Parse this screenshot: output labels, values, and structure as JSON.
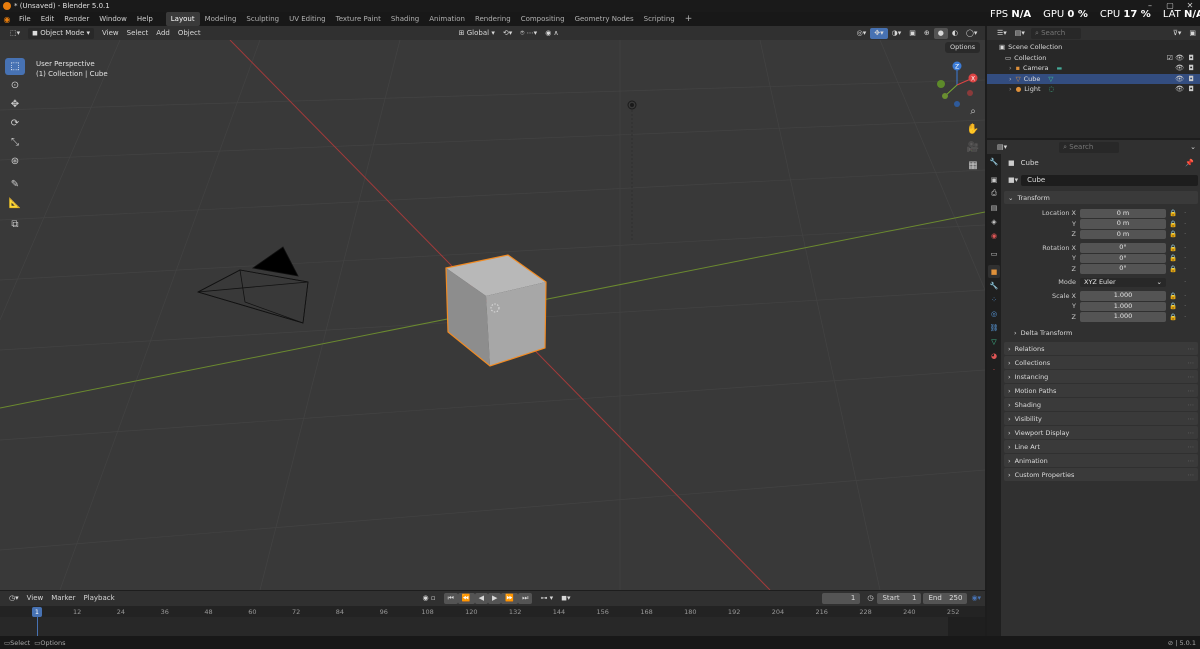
{
  "window": {
    "title": "* (Unsaved) - Blender 5.0.1"
  },
  "menus": [
    "File",
    "Edit",
    "Render",
    "Window",
    "Help"
  ],
  "workspaces": [
    "Layout",
    "Modeling",
    "Sculpting",
    "UV Editing",
    "Texture Paint",
    "Shading",
    "Animation",
    "Rendering",
    "Compositing",
    "Geometry Nodes",
    "Scripting"
  ],
  "active_workspace": "Layout",
  "overlay_stats": {
    "fps_label": "FPS",
    "fps_value": "N/A",
    "gpu_label": "GPU",
    "gpu_value": "0 %",
    "cpu_label": "CPU",
    "cpu_value": "17 %",
    "lat_label": "LAT",
    "lat_value": "N/A"
  },
  "viewport_header": {
    "mode": "Object Mode",
    "menus": [
      "View",
      "Select",
      "Add",
      "Object"
    ],
    "orientation": "Global",
    "options": "Options"
  },
  "viewport": {
    "perspective": "User Perspective",
    "context": "(1) Collection | Cube",
    "gizmo_axes": [
      "X",
      "Y",
      "Z"
    ]
  },
  "outliner": {
    "search_placeholder": "Search",
    "items": [
      {
        "name": "Scene Collection",
        "indent": 0,
        "selected": false
      },
      {
        "name": "Collection",
        "indent": 1,
        "selected": false
      },
      {
        "name": "Camera",
        "indent": 2,
        "selected": false
      },
      {
        "name": "Cube",
        "indent": 2,
        "selected": true
      },
      {
        "name": "Light",
        "indent": 2,
        "selected": false
      }
    ]
  },
  "properties": {
    "search_placeholder": "Search",
    "object_name": "Cube",
    "data_name": "Cube",
    "transform_title": "Transform",
    "location": {
      "label": "Location X",
      "x": "0 m",
      "y": "0 m",
      "z": "0 m"
    },
    "rotation": {
      "label": "Rotation X",
      "x": "0°",
      "y": "0°",
      "z": "0°"
    },
    "mode": {
      "label": "Mode",
      "value": "XYZ Euler"
    },
    "scale": {
      "label": "Scale X",
      "x": "1.000",
      "y": "1.000",
      "z": "1.000"
    },
    "axis_labels": {
      "y": "Y",
      "z": "Z"
    },
    "delta_transform": "Delta Transform",
    "panels": [
      "Relations",
      "Collections",
      "Instancing",
      "Motion Paths",
      "Shading",
      "Visibility",
      "Viewport Display",
      "Line Art",
      "Animation",
      "Custom Properties"
    ]
  },
  "timeline": {
    "menus": [
      "View",
      "Marker",
      "Playback"
    ],
    "current_frame": "1",
    "start_label": "Start",
    "start_value": "1",
    "end_label": "End",
    "end_value": "250",
    "ticks": [
      "1",
      "12",
      "24",
      "36",
      "48",
      "60",
      "72",
      "84",
      "96",
      "108",
      "120",
      "132",
      "144",
      "156",
      "168",
      "180",
      "192",
      "204",
      "216",
      "228",
      "240",
      "252"
    ]
  },
  "statusbar": {
    "select": "Select",
    "options": "Options",
    "version": "5.0.1"
  },
  "colors": {
    "accent": "#4772b3",
    "selection_outline": "#f28b22",
    "x_axis": "#a33a3a",
    "y_axis": "#6b8a2f"
  }
}
